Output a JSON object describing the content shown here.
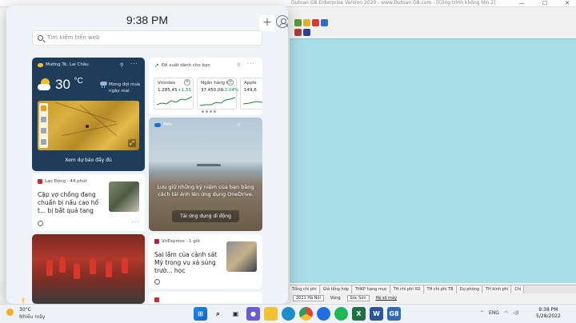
{
  "background_app": {
    "title": "Dutoan G8 Enterprise Version 2020 - www.Dutoan G8.com - [Công trình không tên 2]",
    "sheet_tabs": [
      "Tổng chi phí",
      "Giá tổng hợp",
      "THKP hạng mục",
      "TH chi phí XD",
      "TH chi phí TB",
      "Dự phòng",
      "TH kinh phí",
      "Chi"
    ],
    "status": {
      "region": "2021 Hà Nội",
      "zone_label": "Vùng",
      "zone_value": "Sóc Sơn",
      "coef_label": "Hệ số máy"
    }
  },
  "widgets": {
    "time": "9:38 PM",
    "add_label": "+",
    "search_placeholder": "Tìm kiếm trên web",
    "weather": {
      "location": "Mường Tè, Lai Châu",
      "temperature": "30",
      "unit": "°C",
      "forecast": "Mong đợi mưa ngày mai",
      "link": "Xem dự báo đầy đủ"
    },
    "stocks": {
      "title": "Đề xuất dành cho bạn",
      "items": [
        {
          "name": "Vnindex",
          "price": "1.285,45",
          "change": "+1,33"
        },
        {
          "name": "Ngân hàng t...",
          "price": "37.450,00",
          "change": "+2,04%"
        },
        {
          "name": "Apple",
          "price": "149,6",
          "change": ""
        }
      ]
    },
    "photos": {
      "title": "Ảnh",
      "text": "Lưu giữ những kỷ niệm của bạn bằng cách tải ảnh lên ứng dụng OneDrive.",
      "button": "Tải ứng dụng di động"
    },
    "news1": {
      "source": "Lao Động · 44 phút",
      "title": "Cặp vợ chồng đang chuẩn bị nấu cao hổ t... bị bắt quả tang"
    },
    "news2": {
      "source": "VnExpress · 1 giờ",
      "title": "Sai lầm của cảnh sát Mỹ trong vụ xả súng trườ... học"
    },
    "more": "···"
  },
  "taskbar": {
    "temperature": "30°C",
    "condition": "Nhiều mây",
    "language": "ENG",
    "time": "9:38 PM",
    "date": "5/28/2022"
  },
  "colors": {
    "weather_bg": "#1f3c5b",
    "sheet_bg": "#a8dce6",
    "positive": "#0a8c3a"
  }
}
